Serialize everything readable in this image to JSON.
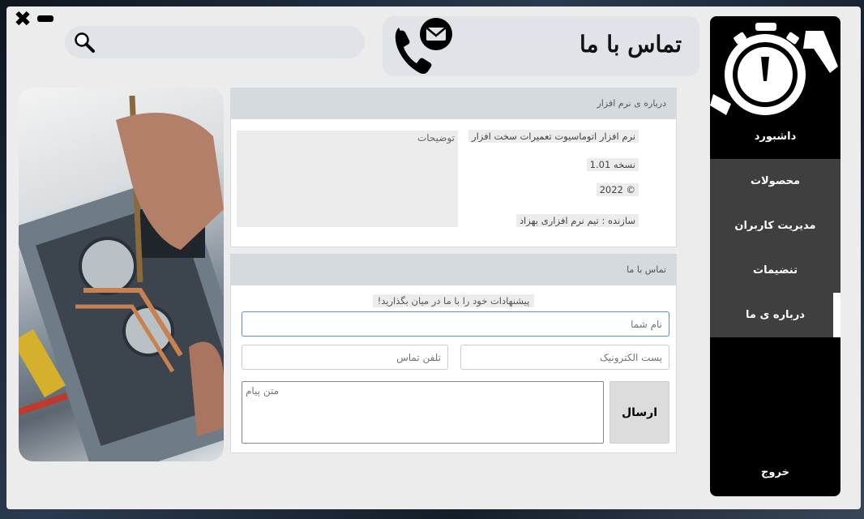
{
  "window": {
    "close_glyph": "✖",
    "minimize_glyph": ""
  },
  "search": {
    "placeholder": "",
    "icon": "search-icon"
  },
  "header": {
    "title": "تماس با ما",
    "icon": "phone-mail-icon"
  },
  "about_panel": {
    "title": "درباره ی نرم افزار",
    "description_placeholder": "توضیحات",
    "app_name": "نرم افزار اتوماسیوت تعمیرات سخت افزار",
    "version": "نسخه 1.01",
    "copyright": "© 2022",
    "author": "سازنده : تیم نرم افزاری بهزاد"
  },
  "contact_panel": {
    "title": "تماس با ما",
    "hint": "پیشنهادات خود را با ما در میان بگذارید!",
    "name_placeholder": "نام شما",
    "phone_placeholder": "تلفن تماس",
    "email_placeholder": "پست الکترونیک",
    "message_placeholder": "متن پیام",
    "send_label": "ارسال"
  },
  "sidebar": {
    "items": [
      {
        "label": "داشبورد",
        "id": "dashboard"
      },
      {
        "label": "محصولات",
        "id": "products"
      },
      {
        "label": "مدیریت کاربران",
        "id": "users"
      },
      {
        "label": "تنضیمات",
        "id": "settings"
      },
      {
        "label": "درباره ی ما",
        "id": "about"
      }
    ],
    "exit_label": "خروج"
  },
  "colors": {
    "sidebar_bg": "#000000",
    "sidebar_item_bg": "#3f3f3f",
    "panel_header_bg": "#d5dadf",
    "window_bg": "#ececec",
    "focus_border": "#5a8fd1"
  }
}
